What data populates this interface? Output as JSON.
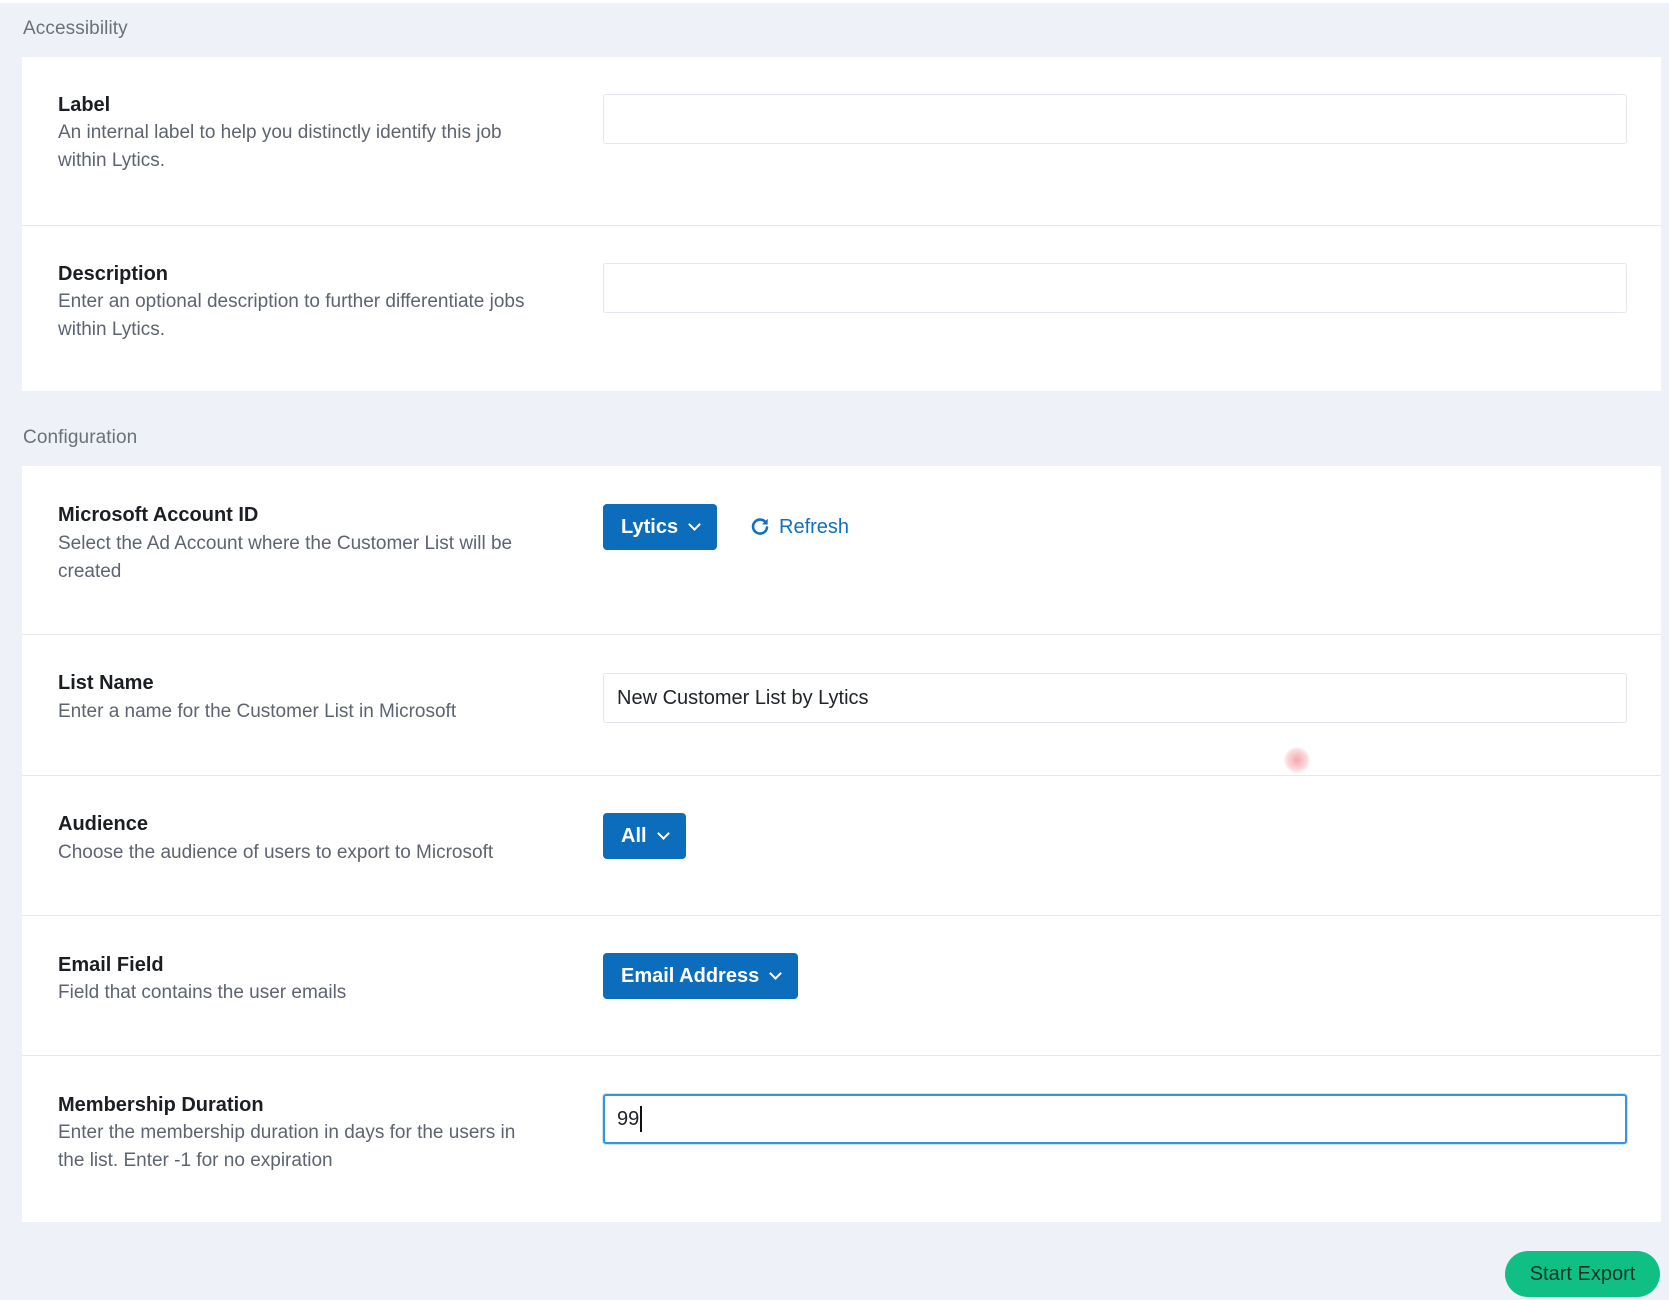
{
  "sections": {
    "accessibility": {
      "heading": "Accessibility",
      "label": {
        "title": "Label",
        "help": "An internal label to help you distinctly identify this job within Lytics.",
        "value": "",
        "placeholder": ""
      },
      "description": {
        "title": "Description",
        "help": "Enter an optional description to further differentiate jobs within Lytics.",
        "value": "",
        "placeholder": ""
      }
    },
    "configuration": {
      "heading": "Configuration",
      "account": {
        "title": "Microsoft Account ID",
        "help": "Select the Ad Account where the Customer List will be created",
        "selected": "Lytics",
        "refresh_label": "Refresh"
      },
      "list_name": {
        "title": "List Name",
        "help": "Enter a name for the Customer List in Microsoft",
        "value": "New Customer List by Lytics"
      },
      "audience": {
        "title": "Audience",
        "help": "Choose the audience of users to export to Microsoft",
        "selected": "All"
      },
      "email_field": {
        "title": "Email Field",
        "help": "Field that contains the user emails",
        "selected": "Email Address"
      },
      "membership_duration": {
        "title": "Membership Duration",
        "help": "Enter the membership duration in days for the users in the list. Enter -1 for no expiration",
        "value": "99"
      }
    }
  },
  "actions": {
    "start_export_label": "Start Export"
  },
  "icons": {
    "refresh": "refresh-icon",
    "dropdown": "chevron-down-icon"
  },
  "colors": {
    "page_background": "#eef1f8",
    "primary_button": "#0b6dbb",
    "link": "#1170bd",
    "success_button": "#0fbf84",
    "focus_ring": "#3a93d6"
  }
}
